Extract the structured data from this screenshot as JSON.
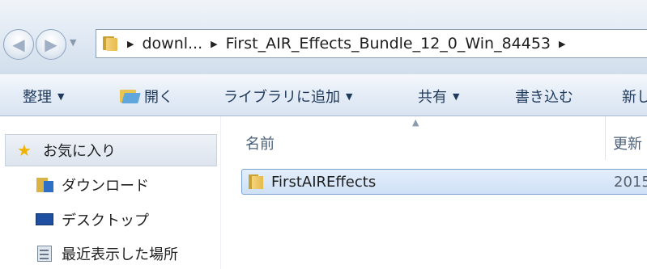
{
  "address_bar": {
    "segments": [
      "downl...",
      "First_AIR_Effects_Bundle_12_0_Win_84453"
    ]
  },
  "toolbar": {
    "organize": "整理",
    "open": "開く",
    "add_to_library": "ライブラリに追加",
    "share": "共有",
    "burn": "書き込む",
    "new": "新し"
  },
  "nav": {
    "favorites": "お気に入り",
    "items": [
      {
        "label": "ダウンロード",
        "icon": "download-folder-icon"
      },
      {
        "label": "デスクトップ",
        "icon": "desktop-icon"
      },
      {
        "label": "最近表示した場所",
        "icon": "recent-places-icon"
      }
    ]
  },
  "file_list": {
    "col_name": "名前",
    "col_date": "更新",
    "rows": [
      {
        "name": "FirstAIREffects",
        "date": "2015",
        "selected": true
      }
    ]
  },
  "colors": {
    "accent": "#1e395b",
    "selection": "#cfe1f6"
  }
}
